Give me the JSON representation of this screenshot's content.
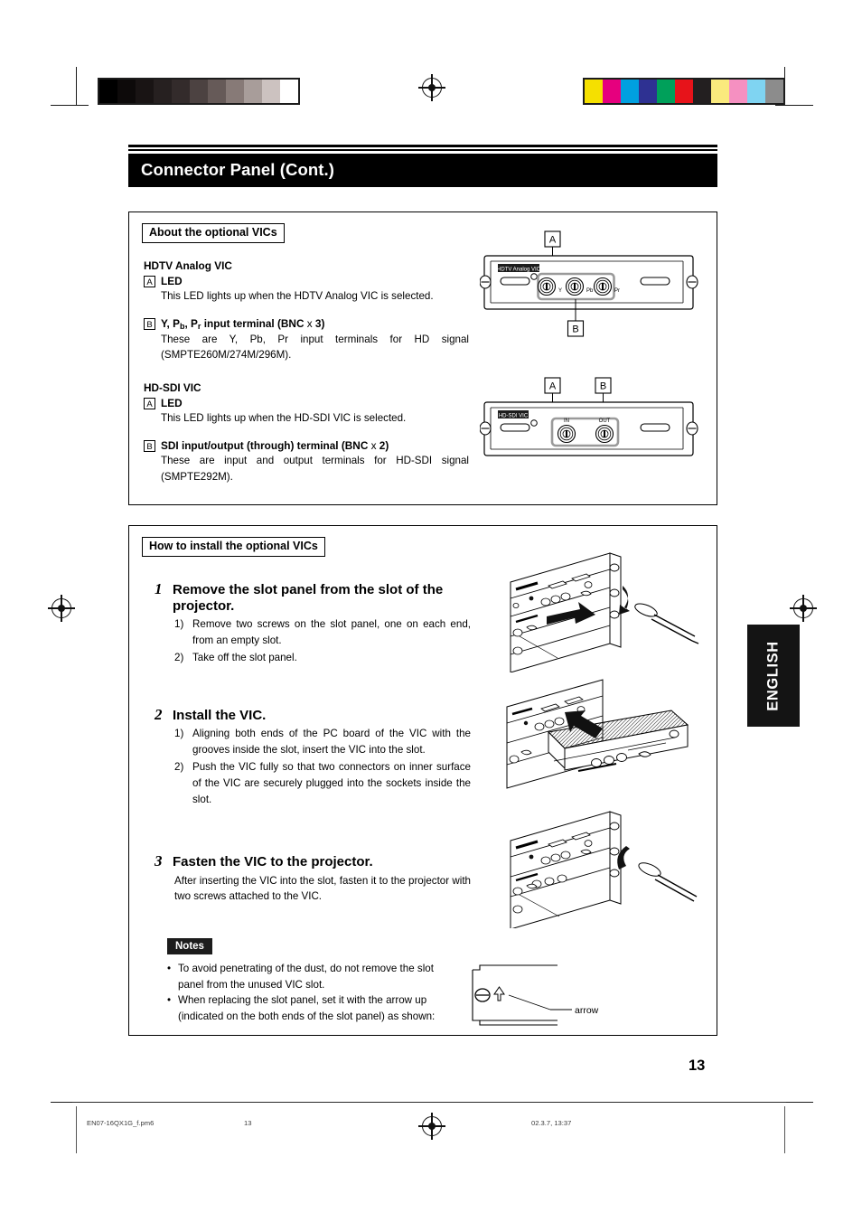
{
  "document": {
    "title": "Connector Panel (Cont.)",
    "page_number": "13",
    "language_tab": "ENGLISH"
  },
  "about_section": {
    "heading": "About the optional VICs",
    "groups": [
      {
        "name": "HDTV Analog VIC",
        "items": [
          {
            "letter": "A",
            "title": "LED",
            "body": "This LED lights up when the HDTV Analog VIC is selected."
          },
          {
            "letter": "B",
            "title_parts": {
              "pre": "Y, P",
              "sub1": "b",
              "mid": ", P",
              "sub2": "r",
              "post": " input terminal (BNC ",
              "times": "x",
              "count": " 3)"
            },
            "title_plain": "Y, Pb, Pr input terminal (BNC x 3)",
            "body": "These are Y, Pb, Pr input terminals for HD signal (SMPTE260M/274M/296M)."
          }
        ],
        "diagram": {
          "panel_label": "HDTV Analog VIC",
          "callouts": [
            "A",
            "B"
          ],
          "connectors": [
            "Y",
            "Pb",
            "Pr"
          ]
        }
      },
      {
        "name": "HD-SDI VIC",
        "items": [
          {
            "letter": "A",
            "title": "LED",
            "body": "This LED lights up when the HD-SDI VIC is selected."
          },
          {
            "letter": "B",
            "title_plain": "SDI input/output (through) terminal (BNC x 2)",
            "title_parts": {
              "pre": "SDI input/output (through) terminal (BNC ",
              "times": "x",
              "count": " 2)"
            },
            "body": "These are input and output terminals for HD-SDI signal (SMPTE292M)."
          }
        ],
        "diagram": {
          "panel_label": "HD-SDI VIC",
          "callouts": [
            "A",
            "B"
          ],
          "connectors": [
            "IN",
            "OUT"
          ]
        }
      }
    ]
  },
  "install_section": {
    "heading": "How to install the optional VICs",
    "steps": [
      {
        "number": "1",
        "title": "Remove the slot panel from the slot of the projector.",
        "substeps": [
          {
            "marker": "1)",
            "text": "Remove two screws on the slot panel, one on each end, from an empty slot."
          },
          {
            "marker": "2)",
            "text": "Take off the slot panel."
          }
        ]
      },
      {
        "number": "2",
        "title": "Install the VIC.",
        "substeps": [
          {
            "marker": "1)",
            "text": "Aligning both ends of the PC board of the VIC with the grooves inside the slot, insert the VIC into the slot."
          },
          {
            "marker": "2)",
            "text": "Push the VIC fully so that two connectors on inner surface of the VIC are securely plugged into the sockets inside the slot."
          }
        ]
      },
      {
        "number": "3",
        "title": "Fasten the VIC to the projector.",
        "body": "After inserting the VIC into the slot, fasten it to the projector with two screws attached to the VIC."
      }
    ],
    "notes": {
      "label": "Notes",
      "bullet": "•",
      "items": [
        "To avoid penetrating of the dust, do not remove the slot panel from the unused VIC slot.",
        "When replacing the slot panel, set it with the arrow up (indicated on the both ends of the slot panel) as shown:"
      ],
      "diagram_label": "arrow"
    }
  },
  "footer": {
    "file_name": "EN07-16QX1G_f.pm6",
    "page": "13",
    "timestamp": "02.3.7, 13:37"
  },
  "calibration": {
    "gray_ramp": [
      "#000000",
      "#0d0a0a",
      "#191414",
      "#262020",
      "#332b2b",
      "#4c4241",
      "#665a58",
      "#877a77",
      "#a89d9a",
      "#ccc2c0",
      "#ffffff"
    ],
    "color_bars": [
      "#f5e000",
      "#e6007e",
      "#00a0e0",
      "#2e3192",
      "#00a05a",
      "#e7131a",
      "#231f20",
      "#faea7d",
      "#f590c1",
      "#7fd4f2",
      "#8c8c8c"
    ]
  }
}
